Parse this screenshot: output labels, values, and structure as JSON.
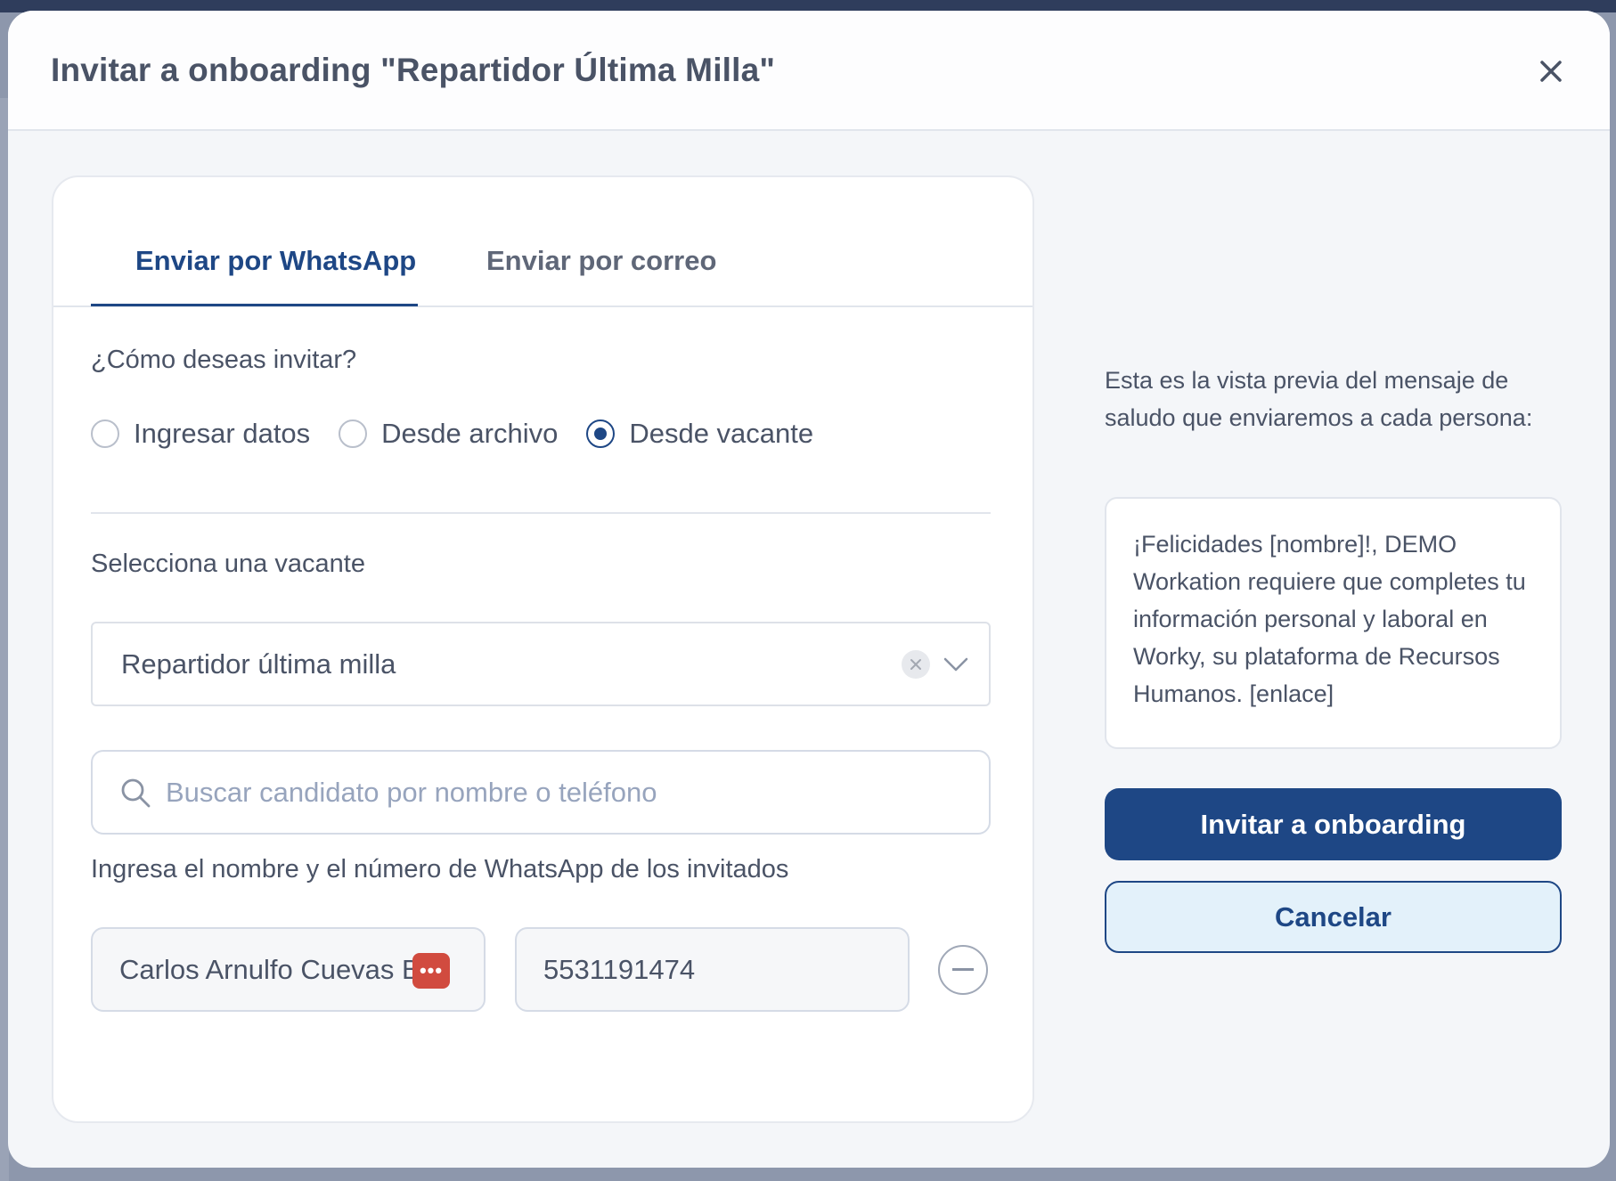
{
  "modal": {
    "title": "Invitar a onboarding \"Repartidor Última Milla\"",
    "close_icon": "close-icon"
  },
  "tabs": [
    {
      "label": "Enviar por WhatsApp",
      "active": true
    },
    {
      "label": "Enviar por correo",
      "active": false
    }
  ],
  "invite_method": {
    "question": "¿Cómo deseas invitar?",
    "options": [
      {
        "label": "Ingresar datos",
        "checked": false
      },
      {
        "label": "Desde archivo",
        "checked": false
      },
      {
        "label": "Desde vacante",
        "checked": true
      }
    ]
  },
  "vacancy": {
    "label": "Selecciona una vacante",
    "selected": "Repartidor última milla"
  },
  "search": {
    "placeholder": "Buscar candidato por nombre o teléfono",
    "value": ""
  },
  "guests": {
    "label": "Ingresa el nombre y el número de WhatsApp de los invitados",
    "rows": [
      {
        "name": "Carlos Arnulfo Cuevas Bar",
        "phone": "5531191474",
        "more_badge": "•••"
      }
    ]
  },
  "preview": {
    "intro": "Esta es la vista previa del mensaje de saludo que enviaremos a cada persona:",
    "message": "¡Felicidades [nombre]!, DEMO Workation requiere que completes tu información personal y laboral en Worky, su plataforma de Recursos Humanos. [enlace]"
  },
  "actions": {
    "primary_label": "Invitar a onboarding",
    "secondary_label": "Cancelar"
  },
  "colors": {
    "accent": "#1e4785",
    "badge": "#d14b3f",
    "secondary_bg": "#e3f1fa"
  }
}
